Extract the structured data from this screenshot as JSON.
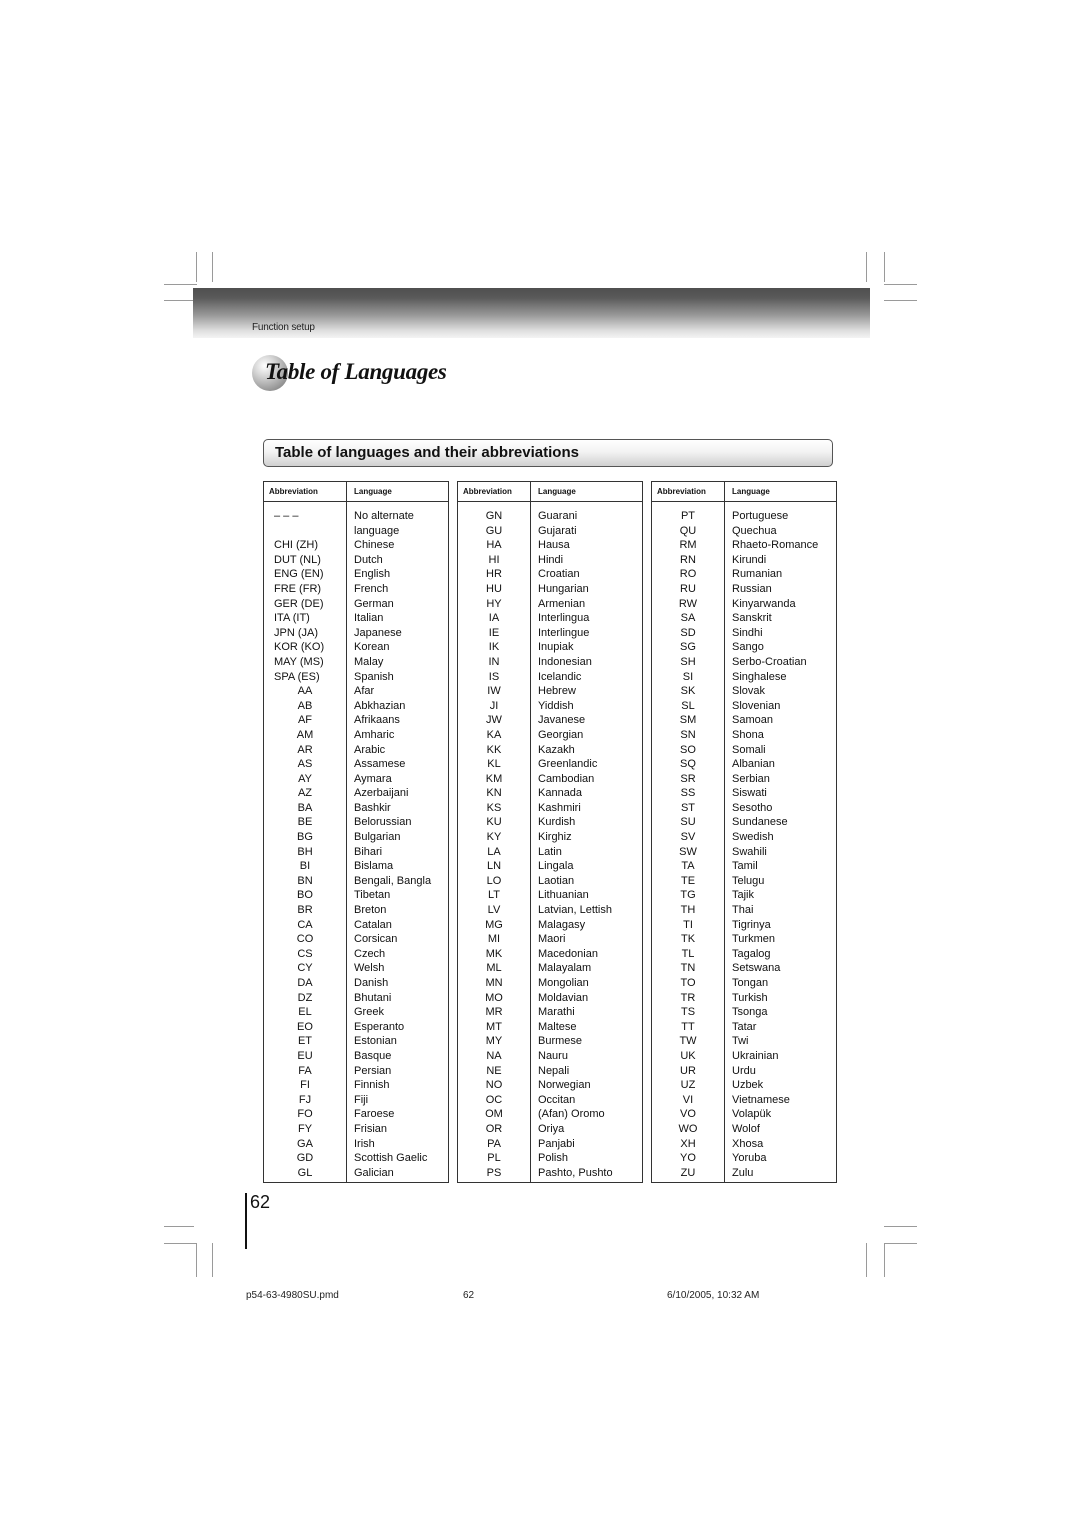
{
  "header": {
    "section_label": "Function setup",
    "title": "Table of Languages"
  },
  "subheading": "Table of languages and their abbreviations",
  "table_headers": {
    "abbreviation": "Abbreviation",
    "language": "Language"
  },
  "tables": [
    {
      "rows": [
        {
          "abbr": "– – –",
          "lang": "No alternate"
        },
        {
          "abbr": "",
          "lang": "language"
        },
        {
          "abbr": "CHI (ZH)",
          "lang": "Chinese"
        },
        {
          "abbr": "DUT (NL)",
          "lang": "Dutch"
        },
        {
          "abbr": "ENG (EN)",
          "lang": "English"
        },
        {
          "abbr": "FRE (FR)",
          "lang": "French"
        },
        {
          "abbr": "GER (DE)",
          "lang": "German"
        },
        {
          "abbr": "ITA (IT)",
          "lang": "Italian"
        },
        {
          "abbr": "JPN (JA)",
          "lang": "Japanese"
        },
        {
          "abbr": "KOR (KO)",
          "lang": "Korean"
        },
        {
          "abbr": "MAY (MS)",
          "lang": "Malay"
        },
        {
          "abbr": "SPA (ES)",
          "lang": "Spanish"
        },
        {
          "abbr": "AA",
          "lang": "Afar"
        },
        {
          "abbr": "AB",
          "lang": "Abkhazian"
        },
        {
          "abbr": "AF",
          "lang": "Afrikaans"
        },
        {
          "abbr": "AM",
          "lang": "Amharic"
        },
        {
          "abbr": "AR",
          "lang": "Arabic"
        },
        {
          "abbr": "AS",
          "lang": "Assamese"
        },
        {
          "abbr": "AY",
          "lang": "Aymara"
        },
        {
          "abbr": "AZ",
          "lang": "Azerbaijani"
        },
        {
          "abbr": "BA",
          "lang": "Bashkir"
        },
        {
          "abbr": "BE",
          "lang": "Belorussian"
        },
        {
          "abbr": "BG",
          "lang": "Bulgarian"
        },
        {
          "abbr": "BH",
          "lang": "Bihari"
        },
        {
          "abbr": "BI",
          "lang": "Bislama"
        },
        {
          "abbr": "BN",
          "lang": "Bengali, Bangla"
        },
        {
          "abbr": "BO",
          "lang": "Tibetan"
        },
        {
          "abbr": "BR",
          "lang": "Breton"
        },
        {
          "abbr": "CA",
          "lang": "Catalan"
        },
        {
          "abbr": "CO",
          "lang": "Corsican"
        },
        {
          "abbr": "CS",
          "lang": "Czech"
        },
        {
          "abbr": "CY",
          "lang": "Welsh"
        },
        {
          "abbr": "DA",
          "lang": "Danish"
        },
        {
          "abbr": "DZ",
          "lang": "Bhutani"
        },
        {
          "abbr": "EL",
          "lang": "Greek"
        },
        {
          "abbr": "EO",
          "lang": "Esperanto"
        },
        {
          "abbr": "ET",
          "lang": "Estonian"
        },
        {
          "abbr": "EU",
          "lang": "Basque"
        },
        {
          "abbr": "FA",
          "lang": "Persian"
        },
        {
          "abbr": "FI",
          "lang": "Finnish"
        },
        {
          "abbr": "FJ",
          "lang": "Fiji"
        },
        {
          "abbr": "FO",
          "lang": "Faroese"
        },
        {
          "abbr": "FY",
          "lang": "Frisian"
        },
        {
          "abbr": "GA",
          "lang": "Irish"
        },
        {
          "abbr": "GD",
          "lang": "Scottish Gaelic"
        },
        {
          "abbr": "GL",
          "lang": "Galician"
        }
      ]
    },
    {
      "rows": [
        {
          "abbr": "GN",
          "lang": "Guarani"
        },
        {
          "abbr": "GU",
          "lang": "Gujarati"
        },
        {
          "abbr": "HA",
          "lang": "Hausa"
        },
        {
          "abbr": "HI",
          "lang": "Hindi"
        },
        {
          "abbr": "HR",
          "lang": "Croatian"
        },
        {
          "abbr": "HU",
          "lang": "Hungarian"
        },
        {
          "abbr": "HY",
          "lang": "Armenian"
        },
        {
          "abbr": "IA",
          "lang": "Interlingua"
        },
        {
          "abbr": "IE",
          "lang": "Interlingue"
        },
        {
          "abbr": "IK",
          "lang": "Inupiak"
        },
        {
          "abbr": "IN",
          "lang": "Indonesian"
        },
        {
          "abbr": "IS",
          "lang": "Icelandic"
        },
        {
          "abbr": "IW",
          "lang": "Hebrew"
        },
        {
          "abbr": "JI",
          "lang": "Yiddish"
        },
        {
          "abbr": "JW",
          "lang": "Javanese"
        },
        {
          "abbr": "KA",
          "lang": "Georgian"
        },
        {
          "abbr": "KK",
          "lang": "Kazakh"
        },
        {
          "abbr": "KL",
          "lang": "Greenlandic"
        },
        {
          "abbr": "KM",
          "lang": "Cambodian"
        },
        {
          "abbr": "KN",
          "lang": "Kannada"
        },
        {
          "abbr": "KS",
          "lang": "Kashmiri"
        },
        {
          "abbr": "KU",
          "lang": "Kurdish"
        },
        {
          "abbr": "KY",
          "lang": "Kirghiz"
        },
        {
          "abbr": "LA",
          "lang": "Latin"
        },
        {
          "abbr": "LN",
          "lang": "Lingala"
        },
        {
          "abbr": "LO",
          "lang": "Laotian"
        },
        {
          "abbr": "LT",
          "lang": "Lithuanian"
        },
        {
          "abbr": "LV",
          "lang": "Latvian, Lettish"
        },
        {
          "abbr": "MG",
          "lang": "Malagasy"
        },
        {
          "abbr": "MI",
          "lang": "Maori"
        },
        {
          "abbr": "MK",
          "lang": "Macedonian"
        },
        {
          "abbr": "ML",
          "lang": "Malayalam"
        },
        {
          "abbr": "MN",
          "lang": "Mongolian"
        },
        {
          "abbr": "MO",
          "lang": "Moldavian"
        },
        {
          "abbr": "MR",
          "lang": "Marathi"
        },
        {
          "abbr": "MT",
          "lang": "Maltese"
        },
        {
          "abbr": "MY",
          "lang": "Burmese"
        },
        {
          "abbr": "NA",
          "lang": "Nauru"
        },
        {
          "abbr": "NE",
          "lang": "Nepali"
        },
        {
          "abbr": "NO",
          "lang": "Norwegian"
        },
        {
          "abbr": "OC",
          "lang": "Occitan"
        },
        {
          "abbr": "OM",
          "lang": "(Afan) Oromo"
        },
        {
          "abbr": "OR",
          "lang": "Oriya"
        },
        {
          "abbr": "PA",
          "lang": "Panjabi"
        },
        {
          "abbr": "PL",
          "lang": "Polish"
        },
        {
          "abbr": "PS",
          "lang": "Pashto, Pushto"
        }
      ]
    },
    {
      "rows": [
        {
          "abbr": "PT",
          "lang": "Portuguese"
        },
        {
          "abbr": "QU",
          "lang": "Quechua"
        },
        {
          "abbr": "RM",
          "lang": "Rhaeto-Romance"
        },
        {
          "abbr": "RN",
          "lang": "Kirundi"
        },
        {
          "abbr": "RO",
          "lang": "Rumanian"
        },
        {
          "abbr": "RU",
          "lang": "Russian"
        },
        {
          "abbr": "RW",
          "lang": "Kinyarwanda"
        },
        {
          "abbr": "SA",
          "lang": "Sanskrit"
        },
        {
          "abbr": "SD",
          "lang": "Sindhi"
        },
        {
          "abbr": "SG",
          "lang": "Sango"
        },
        {
          "abbr": "SH",
          "lang": "Serbo-Croatian"
        },
        {
          "abbr": "SI",
          "lang": "Singhalese"
        },
        {
          "abbr": "SK",
          "lang": "Slovak"
        },
        {
          "abbr": "SL",
          "lang": "Slovenian"
        },
        {
          "abbr": "SM",
          "lang": "Samoan"
        },
        {
          "abbr": "SN",
          "lang": "Shona"
        },
        {
          "abbr": "SO",
          "lang": "Somali"
        },
        {
          "abbr": "SQ",
          "lang": "Albanian"
        },
        {
          "abbr": "SR",
          "lang": "Serbian"
        },
        {
          "abbr": "SS",
          "lang": "Siswati"
        },
        {
          "abbr": "ST",
          "lang": "Sesotho"
        },
        {
          "abbr": "SU",
          "lang": "Sundanese"
        },
        {
          "abbr": "SV",
          "lang": "Swedish"
        },
        {
          "abbr": "SW",
          "lang": "Swahili"
        },
        {
          "abbr": "TA",
          "lang": "Tamil"
        },
        {
          "abbr": "TE",
          "lang": "Telugu"
        },
        {
          "abbr": "TG",
          "lang": "Tajik"
        },
        {
          "abbr": "TH",
          "lang": "Thai"
        },
        {
          "abbr": "TI",
          "lang": "Tigrinya"
        },
        {
          "abbr": "TK",
          "lang": "Turkmen"
        },
        {
          "abbr": "TL",
          "lang": "Tagalog"
        },
        {
          "abbr": "TN",
          "lang": "Setswana"
        },
        {
          "abbr": "TO",
          "lang": "Tongan"
        },
        {
          "abbr": "TR",
          "lang": "Turkish"
        },
        {
          "abbr": "TS",
          "lang": "Tsonga"
        },
        {
          "abbr": "TT",
          "lang": "Tatar"
        },
        {
          "abbr": "TW",
          "lang": "Twi"
        },
        {
          "abbr": "UK",
          "lang": "Ukrainian"
        },
        {
          "abbr": "UR",
          "lang": "Urdu"
        },
        {
          "abbr": "UZ",
          "lang": "Uzbek"
        },
        {
          "abbr": "VI",
          "lang": "Vietnamese"
        },
        {
          "abbr": "VO",
          "lang": "Volapük"
        },
        {
          "abbr": "WO",
          "lang": "Wolof"
        },
        {
          "abbr": "XH",
          "lang": "Xhosa"
        },
        {
          "abbr": "YO",
          "lang": "Yoruba"
        },
        {
          "abbr": "ZU",
          "lang": "Zulu"
        }
      ]
    }
  ],
  "page_number": "62",
  "footer": {
    "filename": "p54-63-4980SU.pmd",
    "page": "62",
    "timestamp": "6/10/2005, 10:32 AM"
  }
}
